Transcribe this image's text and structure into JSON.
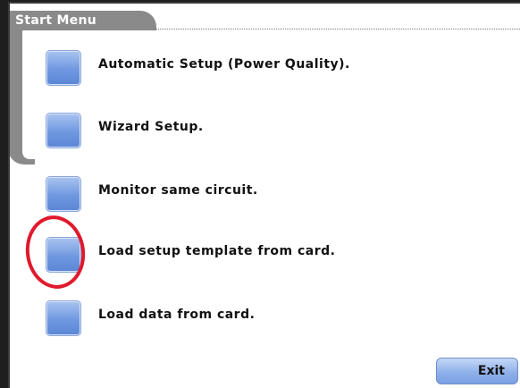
{
  "window": {
    "title": "Start Menu"
  },
  "menu": {
    "items": [
      {
        "label": "Automatic Setup (Power Quality)."
      },
      {
        "label": "Wizard Setup."
      },
      {
        "label": "Monitor same circuit."
      },
      {
        "label": "Load setup template from card."
      },
      {
        "label": "Load data from card."
      }
    ]
  },
  "footer": {
    "exit_label": "Exit"
  },
  "colors": {
    "button_blue": "#6f98e0",
    "frame_gray": "#8a8a8a",
    "highlight_red": "#e0192d"
  }
}
